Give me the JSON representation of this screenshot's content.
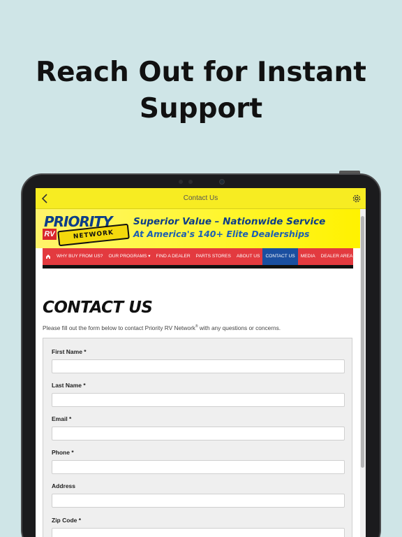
{
  "headline": {
    "line1": "Reach Out for Instant",
    "line2": "Support"
  },
  "app": {
    "nav_title": "Contact Us",
    "back_icon": "chevron-left-icon",
    "settings_icon": "gear-icon"
  },
  "site": {
    "logo_priority": "PRIORITY",
    "logo_rv": "RV",
    "logo_network": "NETWORK",
    "tagline1": "Superior Value – Nationwide Service",
    "tagline2": "At America's 140+ Elite Dealerships",
    "menu": [
      {
        "label": "WHY BUY FROM US?"
      },
      {
        "label": "OUR PROGRAMS ▾"
      },
      {
        "label": "FIND A DEALER"
      },
      {
        "label": "PARTS STORES"
      },
      {
        "label": "ABOUT US"
      },
      {
        "label": "CONTACT US",
        "active": true
      },
      {
        "label": "MEDIA"
      },
      {
        "label": "DEALER AREA"
      }
    ]
  },
  "page": {
    "heading": "CONTACT US",
    "intro_before": "Please fill out the form below to contact Priority RV Network",
    "intro_mark": "®",
    "intro_after": " with any questions or concerns."
  },
  "form": {
    "fields": [
      {
        "label": "First Name *",
        "value": ""
      },
      {
        "label": "Last Name *",
        "value": ""
      },
      {
        "label": "Email *",
        "value": ""
      },
      {
        "label": "Phone *",
        "value": ""
      },
      {
        "label": "Address",
        "value": ""
      },
      {
        "label": "Zip Code *",
        "value": ""
      }
    ]
  },
  "colors": {
    "background": "#cfe5e7",
    "nav_yellow": "#f7ec22",
    "menu_red": "#e33a3f",
    "menu_active_blue": "#1a4fa0",
    "brand_blue": "#0c3d88"
  }
}
